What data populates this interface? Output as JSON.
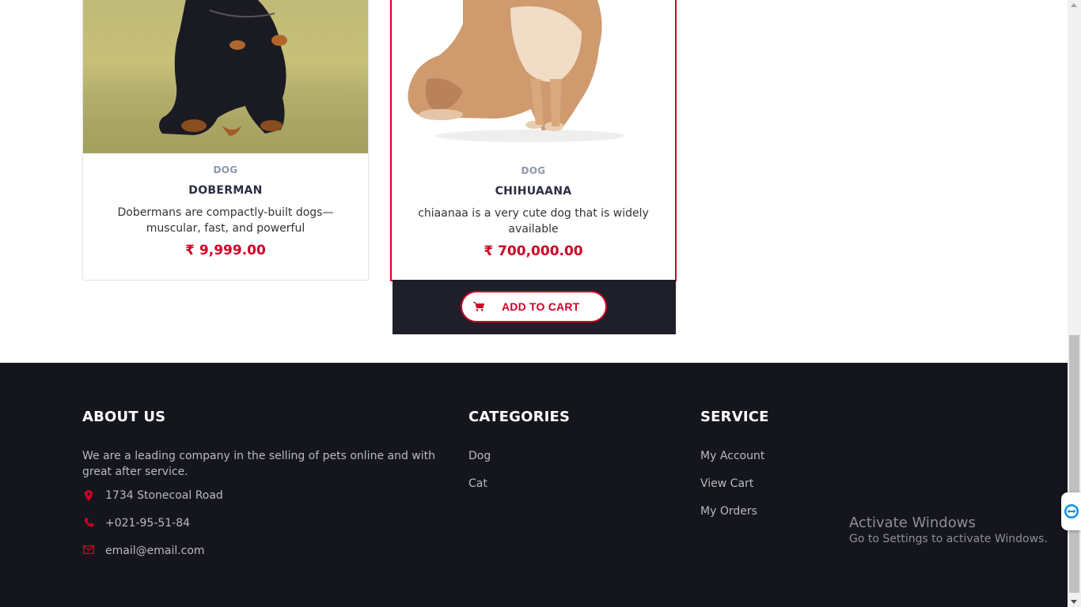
{
  "products": [
    {
      "image_alt": "Doberman dog sitting on grass",
      "category": "DOG",
      "name": "DOBERMAN",
      "description": "Dobermans are compactly-built dogs—muscular, fast, and powerful",
      "price": "₹ 9,999.00"
    },
    {
      "image_alt": "Chihuahua dog sitting on white background",
      "category": "DOG",
      "name": "CHIHUAANA",
      "description": "chiaanaa is a very cute dog that is widely available",
      "price": "₹ 700,000.00"
    }
  ],
  "add_to_cart": {
    "label": "ADD TO CART",
    "icon": "shopping-cart-icon"
  },
  "footer": {
    "about": {
      "title": "ABOUT US",
      "text": "We are a leading company in the selling of pets online and with great after service.",
      "address": "1734 Stonecoal Road",
      "phone": "+021-95-51-84",
      "email": "email@email.com"
    },
    "categories": {
      "title": "CATEGORIES",
      "links": [
        "Dog",
        "Cat"
      ]
    },
    "service": {
      "title": "SERVICE",
      "links": [
        "My Account",
        "View Cart",
        "My Orders"
      ]
    }
  },
  "windows_watermark": {
    "title": "Activate Windows",
    "subtitle": "Go to Settings to activate Windows."
  },
  "colors": {
    "accent": "#d10024",
    "footer_bg": "#15161d",
    "cart_bar_bg": "#1e1f29",
    "muted_text": "#8d99ae"
  }
}
